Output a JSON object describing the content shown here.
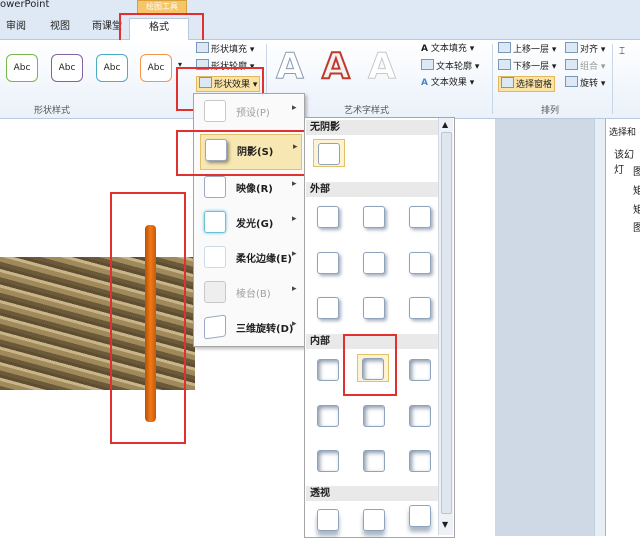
{
  "app": {
    "title": "owerPoint",
    "context_tab": "绘图工具"
  },
  "tabs": [
    {
      "label": "审阅"
    },
    {
      "label": "视图"
    },
    {
      "label": "雨课堂"
    },
    {
      "label": "格式",
      "active": true
    }
  ],
  "ribbon": {
    "shape_styles": {
      "swatch_label": "Abc",
      "swatch_colors": [
        "#7ab648",
        "#8064a2",
        "#4bacc6",
        "#f79646"
      ],
      "group_label": "形状样式",
      "fill": "形状填充",
      "outline": "形状轮廓",
      "effects": "形状效果"
    },
    "wordart": {
      "group_label": "艺术字样式",
      "text_fill": "文本填充",
      "text_outline": "文本轮廓",
      "text_effects": "文本效果"
    },
    "arrange": {
      "group_label": "排列",
      "bring_forward": "上移一层",
      "send_backward": "下移一层",
      "selection_pane": "选择窗格",
      "align": "对齐",
      "group": "组合",
      "rotate": "旋转"
    }
  },
  "effects_menu": [
    {
      "label": "预设(P)",
      "enabled": false
    },
    {
      "label": "阴影(S)",
      "enabled": true,
      "highlighted": true
    },
    {
      "label": "映像(R)",
      "enabled": true
    },
    {
      "label": "发光(G)",
      "enabled": true
    },
    {
      "label": "柔化边缘(E)",
      "enabled": true
    },
    {
      "label": "棱台(B)",
      "enabled": false
    },
    {
      "label": "三维旋转(D)",
      "enabled": true
    }
  ],
  "shadow_gallery": {
    "sections": {
      "none": "无阴影",
      "outer": "外部",
      "inner": "内部",
      "perspective": "透视"
    }
  },
  "selection_pane": {
    "header": "选择和",
    "label": "该幻灯",
    "items": [
      "图",
      "矩",
      "矩",
      "图"
    ]
  }
}
